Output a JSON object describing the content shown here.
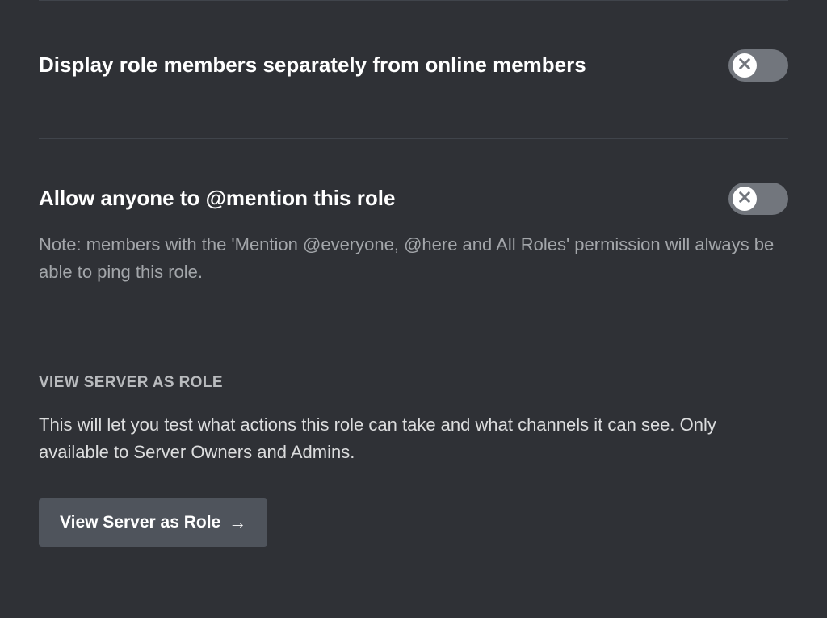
{
  "settings": {
    "displaySeparately": {
      "label": "Display role members separately from online members",
      "state": "off"
    },
    "allowMention": {
      "label_prefix": "Allow anyone to ",
      "label_strong": "@mention",
      "label_suffix": " this role",
      "state": "off",
      "note": "Note: members with the 'Mention @everyone, @here and All Roles' permission will always be able to ping this role."
    }
  },
  "viewAsRole": {
    "heading": "View Server as Role",
    "description": "This will let you test what actions this role can take and what channels it can see. Only available to Server Owners and Admins.",
    "button_label": "View Server as Role"
  }
}
